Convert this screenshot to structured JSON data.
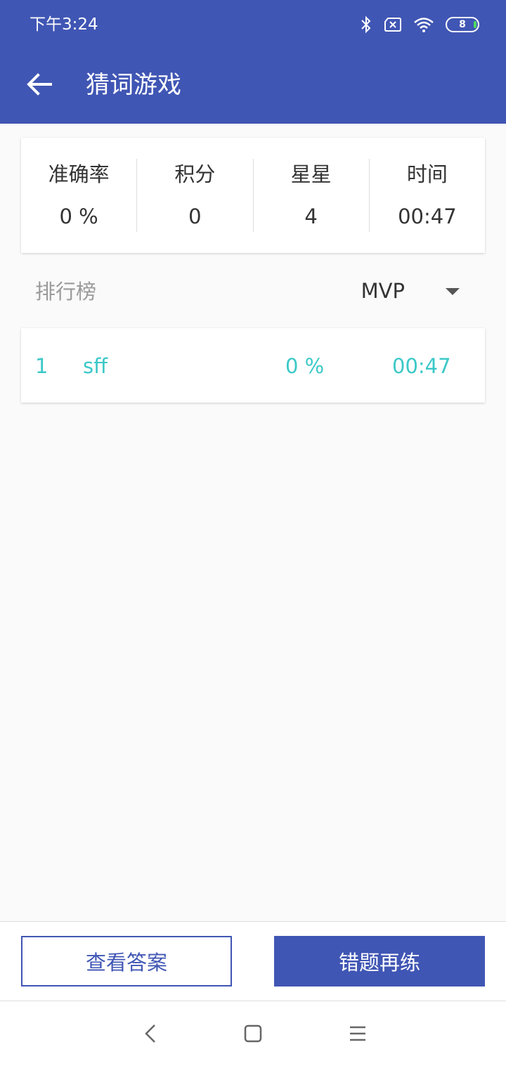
{
  "status_bar": {
    "time": "下午3:24",
    "battery_level": "8",
    "icons": [
      "bluetooth-icon",
      "sim-off-icon",
      "wifi-icon",
      "battery-icon"
    ]
  },
  "header": {
    "title": "猜词游戏",
    "back_icon": "arrow-left-icon"
  },
  "stats": [
    {
      "label": "准确率",
      "value": "0 %"
    },
    {
      "label": "积分",
      "value": "0"
    },
    {
      "label": "星星",
      "value": "4"
    },
    {
      "label": "时间",
      "value": "00:47"
    }
  ],
  "leaderboard": {
    "title": "排行榜",
    "selected": "MVP",
    "dropdown_icon": "caret-down-icon",
    "rows": [
      {
        "rank": "1",
        "name": "sff",
        "accuracy": "0 %",
        "time": "00:47"
      }
    ]
  },
  "actions": {
    "view_answers": "查看答案",
    "retry_wrong": "错题再练"
  },
  "nav": {
    "icons": [
      "nav-back-icon",
      "nav-home-icon",
      "nav-menu-icon"
    ]
  },
  "colors": {
    "primary": "#4056b4",
    "accent": "#3cc8c8",
    "background": "#fafafa"
  }
}
